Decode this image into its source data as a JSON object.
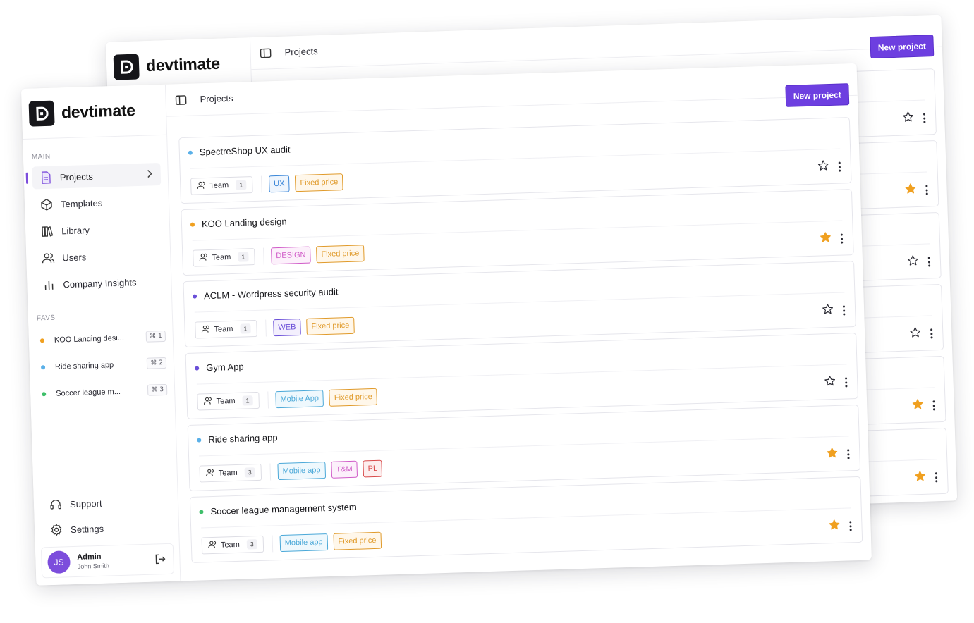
{
  "brand": {
    "name": "devtimate"
  },
  "colors": {
    "accent": "#6d3fe0",
    "star_on": "#f0a020",
    "star_off": "#2a2a33"
  },
  "back_window": {
    "breadcrumb": "Projects",
    "new_project_label": "New project",
    "rows": [
      {
        "favorite": false
      },
      {
        "favorite": true
      },
      {
        "favorite": false
      },
      {
        "favorite": false
      },
      {
        "favorite": true
      },
      {
        "favorite": true
      }
    ]
  },
  "sidebar": {
    "main_label": "MAIN",
    "items": [
      {
        "label": "Projects",
        "icon": "document-icon",
        "active": true
      },
      {
        "label": "Templates",
        "icon": "cube-icon",
        "active": false
      },
      {
        "label": "Library",
        "icon": "library-icon",
        "active": false
      },
      {
        "label": "Users",
        "icon": "users-icon",
        "active": false
      },
      {
        "label": "Company Insights",
        "icon": "bar-chart-icon",
        "active": false
      }
    ],
    "favs_label": "FAVS",
    "favs": [
      {
        "label": "KOO Landing desi...",
        "shortcut": "⌘ 1",
        "color": "#f0a020"
      },
      {
        "label": "Ride sharing app",
        "shortcut": "⌘ 2",
        "color": "#5ab0e8"
      },
      {
        "label": "Soccer league m...",
        "shortcut": "⌘ 3",
        "color": "#3fbf6a"
      }
    ],
    "support_label": "Support",
    "settings_label": "Settings",
    "user": {
      "initials": "JS",
      "role": "Admin",
      "name": "John Smith"
    }
  },
  "header": {
    "breadcrumb": "Projects",
    "new_project_label": "New project"
  },
  "projects": [
    {
      "title": "SpectreShop UX audit",
      "dot_color": "#5ab0e8",
      "team_label": "Team",
      "team_count": "1",
      "favorite": false,
      "tags": [
        {
          "label": "UX",
          "color": "#3a86d8",
          "bg": "#eef5fd"
        },
        {
          "label": "Fixed price",
          "color": "#e09a2a",
          "bg": "#fff7ea"
        }
      ]
    },
    {
      "title": "KOO Landing design",
      "dot_color": "#f0a020",
      "team_label": "Team",
      "team_count": "1",
      "favorite": true,
      "tags": [
        {
          "label": "DESIGN",
          "color": "#d05cc8",
          "bg": "#fcf0fb"
        },
        {
          "label": "Fixed price",
          "color": "#e09a2a",
          "bg": "#fff7ea"
        }
      ]
    },
    {
      "title": "ACLM - Wordpress security audit",
      "dot_color": "#6a4fd8",
      "team_label": "Team",
      "team_count": "1",
      "favorite": false,
      "tags": [
        {
          "label": "WEB",
          "color": "#6a4fd8",
          "bg": "#f3effd"
        },
        {
          "label": "Fixed price",
          "color": "#e09a2a",
          "bg": "#fff7ea"
        }
      ]
    },
    {
      "title": "Gym App",
      "dot_color": "#6a4fd8",
      "team_label": "Team",
      "team_count": "1",
      "favorite": false,
      "tags": [
        {
          "label": "Mobile App",
          "color": "#4aa8d8",
          "bg": "#eef8fd"
        },
        {
          "label": "Fixed price",
          "color": "#e09a2a",
          "bg": "#fff7ea"
        }
      ]
    },
    {
      "title": "Ride sharing app",
      "dot_color": "#5ab0e8",
      "team_label": "Team",
      "team_count": "3",
      "favorite": true,
      "tags": [
        {
          "label": "Mobile app",
          "color": "#4aa8d8",
          "bg": "#eef8fd"
        },
        {
          "label": "T&M",
          "color": "#d05cc8",
          "bg": "#fcf0fb"
        },
        {
          "label": "PL",
          "color": "#d84a4a",
          "bg": "#fdeeee"
        }
      ]
    },
    {
      "title": "Soccer league management system",
      "dot_color": "#3fbf6a",
      "team_label": "Team",
      "team_count": "3",
      "favorite": true,
      "tags": [
        {
          "label": "Mobile app",
          "color": "#4aa8d8",
          "bg": "#eef8fd"
        },
        {
          "label": "Fixed price",
          "color": "#e09a2a",
          "bg": "#fff7ea"
        }
      ]
    }
  ]
}
